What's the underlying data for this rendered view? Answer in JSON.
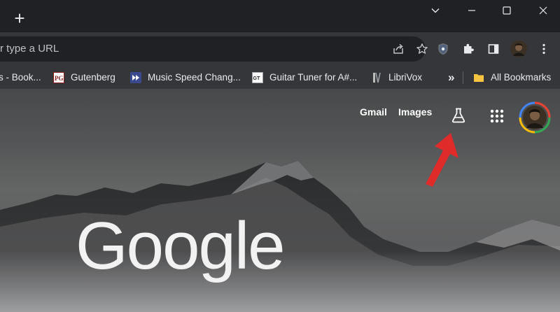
{
  "browser": {
    "tabstrip": {
      "new_tab_symbol": "+",
      "window_controls": [
        "chevron-down-icon",
        "minimize-icon",
        "maximize-icon",
        "close-icon"
      ]
    },
    "omnibox": {
      "placeholder": "r type a URL"
    },
    "toolbar_icons": [
      "share-icon",
      "star-icon",
      "shield-extension-icon",
      "puzzle-extensions-icon",
      "side-panel-icon",
      "profile-avatar",
      "menu-dots-icon"
    ]
  },
  "bookmarks": {
    "items": [
      {
        "label": "s - Book..."
      },
      {
        "label": "Gutenberg",
        "icon_text": "PG"
      },
      {
        "label": "Music Speed Chang..."
      },
      {
        "label": "Guitar Tuner for A#...",
        "icon_text": "GT"
      },
      {
        "label": "LibriVox"
      }
    ],
    "overflow": "»",
    "all_bookmarks": "All Bookmarks"
  },
  "ntp": {
    "gmail": "Gmail",
    "images": "Images",
    "logo": "Google"
  },
  "colors": {
    "accent_arrow": "#e02b2b",
    "tab_background": "#202124",
    "toolbar_background": "#35363a"
  }
}
